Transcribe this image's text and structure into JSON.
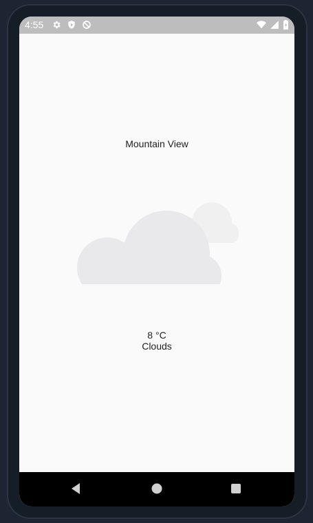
{
  "status_bar": {
    "time": "4:55",
    "icons_left": [
      "gear-icon",
      "play-protect-icon",
      "data-saver-icon"
    ],
    "icons_right": [
      "wifi-icon",
      "signal-icon",
      "battery-icon"
    ]
  },
  "weather": {
    "city": "Mountain View",
    "temperature": "8 °C",
    "description": "Clouds",
    "art_icon": "clouds-icon"
  },
  "navigation": {
    "back_icon": "back-icon",
    "home_icon": "home-icon",
    "recents_icon": "recents-icon"
  },
  "colors": {
    "status_bar": "#bdbdbd",
    "background": "#fafafa",
    "cloud_front": "#e9e8ea",
    "cloud_back": "#f1f0f1",
    "nav_bar": "#000000"
  }
}
